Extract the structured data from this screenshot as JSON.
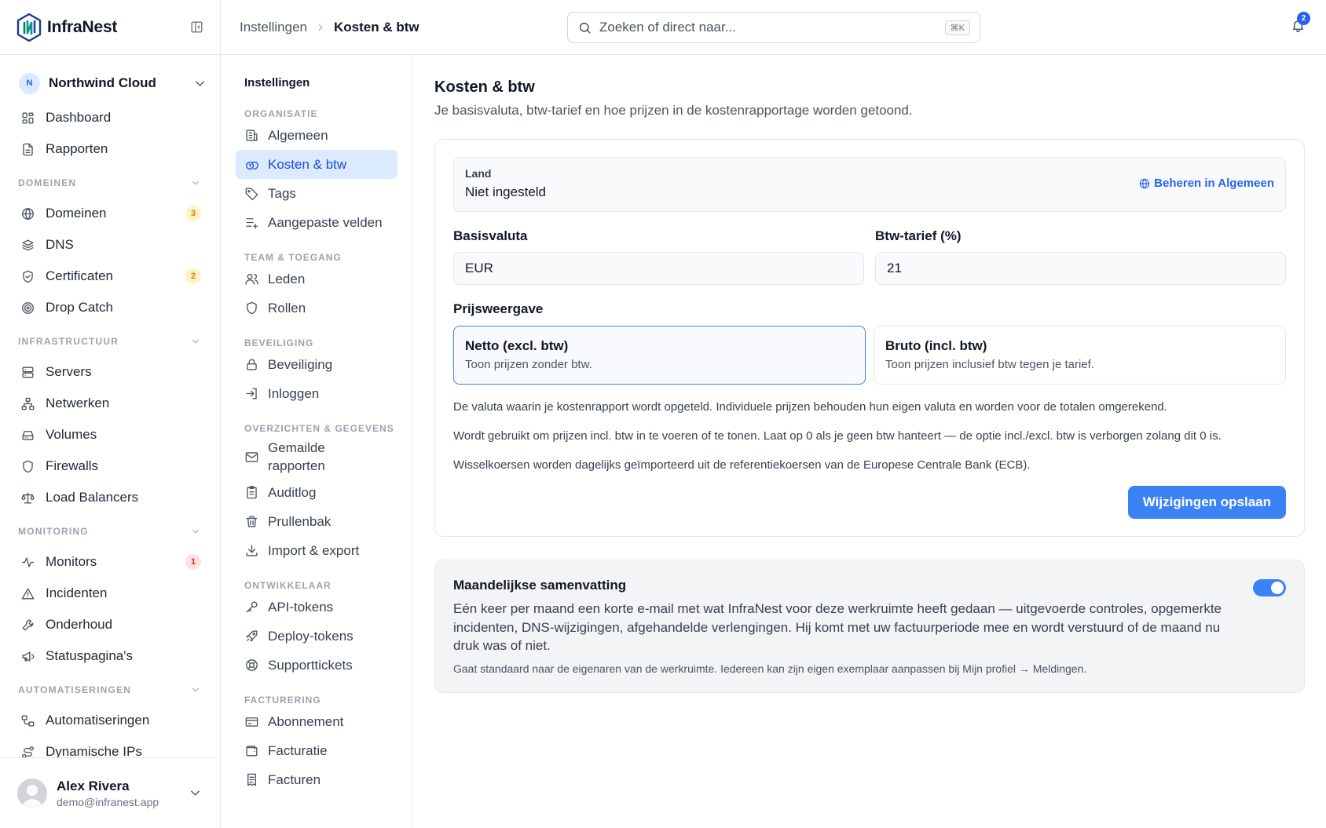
{
  "app": {
    "name": "InfraNest"
  },
  "workspace": {
    "initial": "N",
    "name": "Northwind Cloud"
  },
  "sidebar": {
    "top_items": [
      {
        "label": "Dashboard",
        "icon": "dashboard-icon"
      },
      {
        "label": "Rapporten",
        "icon": "report-icon"
      }
    ],
    "groups": [
      {
        "label": "DOMEINEN",
        "items": [
          {
            "label": "Domeinen",
            "icon": "globe-icon",
            "badge": "3",
            "badge_color": "#d97706"
          },
          {
            "label": "DNS",
            "icon": "layers-icon"
          },
          {
            "label": "Certificaten",
            "icon": "shield-check-icon",
            "badge": "2",
            "badge_color": "#d97706"
          },
          {
            "label": "Drop Catch",
            "icon": "target-icon"
          }
        ]
      },
      {
        "label": "INFRASTRUCTUUR",
        "items": [
          {
            "label": "Servers",
            "icon": "server-icon"
          },
          {
            "label": "Netwerken",
            "icon": "network-icon"
          },
          {
            "label": "Volumes",
            "icon": "harddrive-icon"
          },
          {
            "label": "Firewalls",
            "icon": "shield-icon"
          },
          {
            "label": "Load Balancers",
            "icon": "scale-icon"
          }
        ]
      },
      {
        "label": "MONITORING",
        "items": [
          {
            "label": "Monitors",
            "icon": "activity-icon",
            "badge": "1",
            "badge_color": "#dc2626"
          },
          {
            "label": "Incidenten",
            "icon": "alert-triangle-icon"
          },
          {
            "label": "Onderhoud",
            "icon": "wrench-icon"
          },
          {
            "label": "Statuspagina's",
            "icon": "megaphone-icon"
          }
        ]
      },
      {
        "label": "AUTOMATISERINGEN",
        "items": [
          {
            "label": "Automatiseringen",
            "icon": "workflow-icon"
          },
          {
            "label": "Dynamische IPs",
            "icon": "route-icon"
          }
        ]
      }
    ],
    "user": {
      "name": "Alex Rivera",
      "email": "demo@infranest.app"
    }
  },
  "topbar": {
    "breadcrumb": [
      "Instellingen",
      "Kosten & btw"
    ],
    "search_placeholder": "Zoeken of direct naar...",
    "search_shortcut": "⌘K",
    "notifications_count": "2"
  },
  "settings_nav": {
    "title": "Instellingen",
    "groups": [
      {
        "label": "ORGANISATIE",
        "items": [
          {
            "label": "Algemeen",
            "icon": "building-icon"
          },
          {
            "label": "Kosten & btw",
            "icon": "coins-icon",
            "active": true
          },
          {
            "label": "Tags",
            "icon": "tag-icon"
          },
          {
            "label": "Aangepaste velden",
            "icon": "list-plus-icon"
          }
        ]
      },
      {
        "label": "TEAM & TOEGANG",
        "items": [
          {
            "label": "Leden",
            "icon": "users-icon"
          },
          {
            "label": "Rollen",
            "icon": "shield-icon"
          }
        ]
      },
      {
        "label": "BEVEILIGING",
        "items": [
          {
            "label": "Beveiliging",
            "icon": "lock-icon"
          },
          {
            "label": "Inloggen",
            "icon": "login-icon"
          }
        ]
      },
      {
        "label": "OVERZICHTEN & GEGEVENS",
        "items": [
          {
            "label": "Gemailde rapporten",
            "icon": "mail-icon"
          },
          {
            "label": "Auditlog",
            "icon": "clipboard-icon"
          },
          {
            "label": "Prullenbak",
            "icon": "trash-icon"
          },
          {
            "label": "Import & export",
            "icon": "download-icon"
          }
        ]
      },
      {
        "label": "ONTWIKKELAAR",
        "items": [
          {
            "label": "API-tokens",
            "icon": "key-icon"
          },
          {
            "label": "Deploy-tokens",
            "icon": "rocket-icon"
          },
          {
            "label": "Supporttickets",
            "icon": "lifebuoy-icon"
          }
        ]
      },
      {
        "label": "FACTURERING",
        "items": [
          {
            "label": "Abonnement",
            "icon": "credit-card-icon"
          },
          {
            "label": "Facturatie",
            "icon": "wallet-icon"
          },
          {
            "label": "Facturen",
            "icon": "receipt-icon"
          }
        ]
      }
    ]
  },
  "main": {
    "title": "Kosten & btw",
    "subtitle": "Je basisvaluta, btw-tarief en hoe prijzen in de kostenrapportage worden getoond.",
    "country": {
      "label": "Land",
      "value": "Niet ingesteld",
      "link": "Beheren in Algemeen"
    },
    "currency": {
      "label": "Basisvaluta",
      "value": "EUR"
    },
    "vat": {
      "label": "Btw-tarief (%)",
      "value": "21"
    },
    "price_display": {
      "label": "Prijsweergave",
      "options": [
        {
          "title": "Netto (excl. btw)",
          "desc": "Toon prijzen zonder btw.",
          "selected": true
        },
        {
          "title": "Bruto (incl. btw)",
          "desc": "Toon prijzen inclusief btw tegen je tarief.",
          "selected": false
        }
      ]
    },
    "help": [
      "De valuta waarin je kostenrapport wordt opgeteld. Individuele prijzen behouden hun eigen valuta en worden voor de totalen omgerekend.",
      "Wordt gebruikt om prijzen incl. btw in te voeren of te tonen. Laat op 0 als je geen btw hanteert — de optie incl./excl. btw is verborgen zolang dit 0 is.",
      "Wisselkoersen worden dagelijks geïmporteerd uit de referentiekoersen van de Europese Centrale Bank (ECB)."
    ],
    "save_label": "Wijzigingen opslaan",
    "summary": {
      "title": "Maandelijkse samenvatting",
      "body": "Eén keer per maand een korte e-mail met wat InfraNest voor deze werkruimte heeft gedaan — uitgevoerde controles, opgemerkte incidenten, DNS-wijzigingen, afgehandelde verlengingen. Hij komt met uw factuurperiode mee en wordt verstuurd of de maand nu druk was of niet.",
      "note": "Gaat standaard naar de eigenaren van de werkruimte. Iedereen kan zijn eigen exemplaar aanpassen bij Mijn profiel → Meldingen.",
      "enabled": true
    }
  },
  "colors": {
    "accent": "#3b82f6",
    "active_bg": "#dbeafe",
    "active_text": "#1d4ed8"
  }
}
